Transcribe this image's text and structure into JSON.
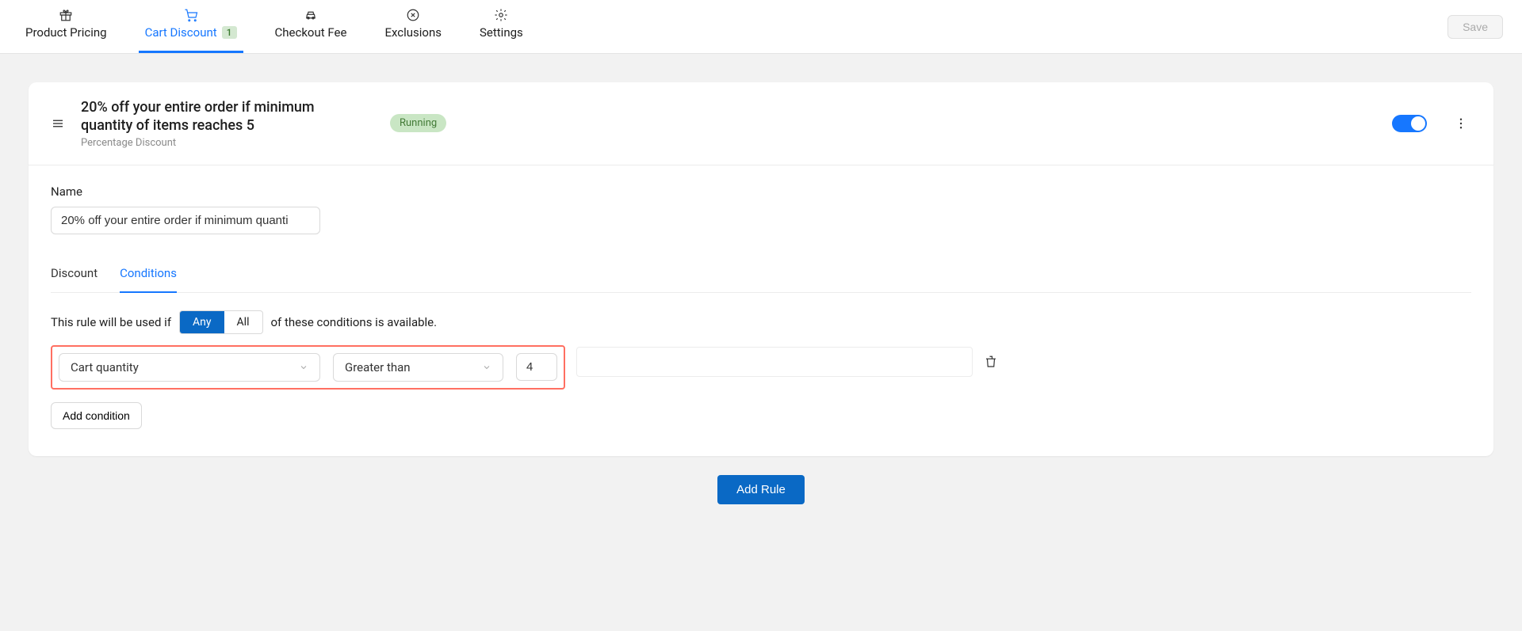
{
  "topTabs": {
    "productPricing": "Product Pricing",
    "cartDiscount": "Cart Discount",
    "cartDiscountBadge": "1",
    "checkoutFee": "Checkout Fee",
    "exclusions": "Exclusions",
    "settings": "Settings"
  },
  "saveBtn": "Save",
  "rule": {
    "title": "20% off your entire order if minimum quantity of items reaches 5",
    "subtitle": "Percentage Discount",
    "status": "Running",
    "nameLabel": "Name",
    "nameValue": "20% off your entire order if minimum quanti"
  },
  "innerTabs": {
    "discount": "Discount",
    "conditions": "Conditions"
  },
  "conditions": {
    "prefix": "This rule will be used if",
    "any": "Any",
    "all": "All",
    "suffix": "of these conditions is available.",
    "row": {
      "type": "Cart quantity",
      "operator": "Greater than",
      "value": "4"
    },
    "addCondition": "Add condition"
  },
  "addRule": "Add Rule"
}
